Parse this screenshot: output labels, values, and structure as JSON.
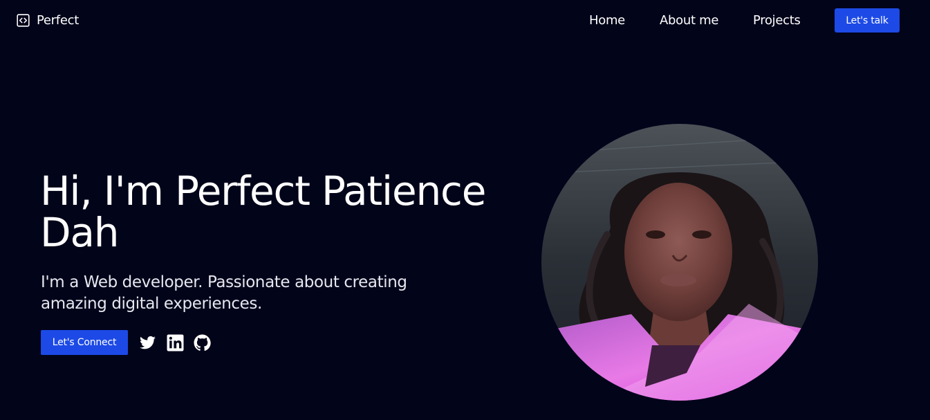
{
  "brand": {
    "name": "Perfect",
    "icon": "code-brackets-icon"
  },
  "nav": {
    "items": [
      {
        "label": "Home"
      },
      {
        "label": "About me"
      },
      {
        "label": "Projects"
      }
    ],
    "cta_label": "Let's talk"
  },
  "hero": {
    "title": "Hi, I'm Perfect Patience Dah",
    "subtitle": "I'm a Web developer. Passionate about creating amazing digital experiences.",
    "cta_label": "Let's Connect",
    "social": [
      "twitter-icon",
      "linkedin-icon",
      "github-icon"
    ]
  },
  "colors": {
    "background": "#02041a",
    "accent": "#1d4ae6",
    "text": "#ffffff"
  }
}
